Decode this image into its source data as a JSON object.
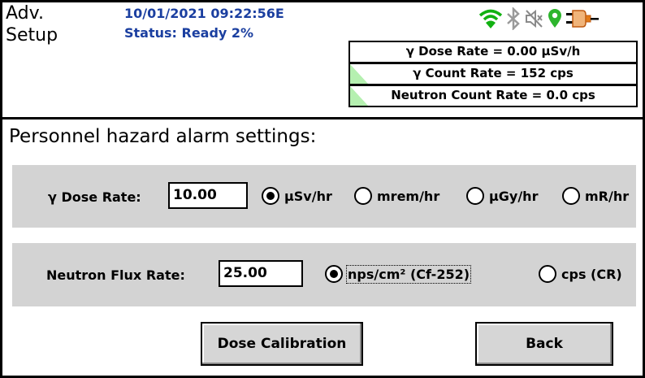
{
  "header": {
    "page_title": "Adv.\nSetup",
    "datetime": "10/01/2021 09:22:56E",
    "status": "Status: Ready 2%"
  },
  "status_icons": [
    "wifi-icon",
    "bluetooth-icon",
    "sound-muted-icon",
    "gps-pin-icon",
    "power-plug-icon"
  ],
  "rates": {
    "gamma_dose_rate": "γ Dose Rate = 0.00  μSv/h",
    "gamma_count_rate": "γ Count Rate = 152 cps",
    "neutron_count_rate": "Neutron Count Rate = 0.0 cps"
  },
  "section_title": "Personnel hazard alarm settings:",
  "gamma_panel": {
    "label": "γ Dose Rate:",
    "value": "10.00",
    "units": [
      {
        "label": "μSv/hr",
        "selected": true
      },
      {
        "label": "mrem/hr",
        "selected": false
      },
      {
        "label": "μGy/hr",
        "selected": false
      },
      {
        "label": "mR/hr",
        "selected": false
      }
    ]
  },
  "neutron_panel": {
    "label": "Neutron Flux Rate:",
    "value": "25.00",
    "units": [
      {
        "label": "nps/cm² (Cf-252)",
        "selected": true
      },
      {
        "label": "cps (CR)",
        "selected": false
      }
    ]
  },
  "buttons": {
    "dose_calibration": "Dose Calibration",
    "back": "Back"
  },
  "colors": {
    "header_text": "#1b3fa0",
    "panel_bg": "#d3d3d3",
    "wifi": "#11b111",
    "gps": "#2db52d",
    "plug": "#e07a1a",
    "rate_indicator": "#b5f0b0"
  }
}
